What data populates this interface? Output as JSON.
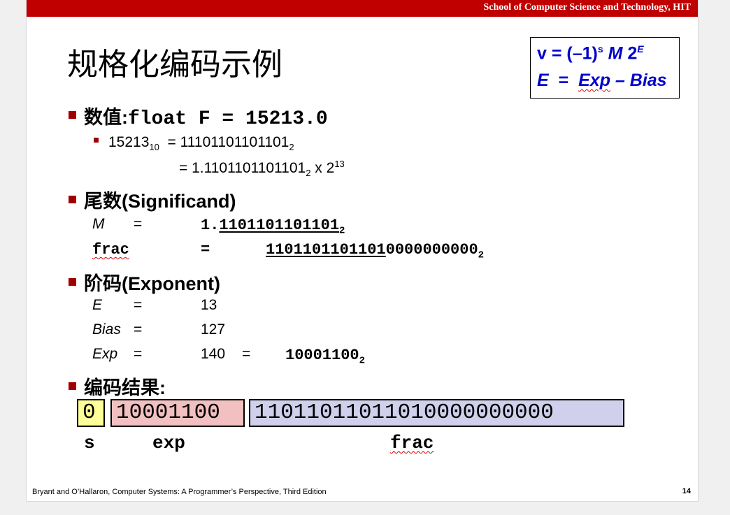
{
  "header": {
    "institution": "School of Computer Science and Technology, HIT"
  },
  "title": "规格化编码示例",
  "formula": {
    "line1_prefix": "v = (–1)",
    "line1_sup_s": "s",
    "line1_m": "M",
    "line1_two": "2",
    "line1_sup_e": "E",
    "line2_e": "E",
    "line2_eq": "=",
    "line2_exp": "Exp",
    "line2_rest": "– Bias"
  },
  "value_section": {
    "label": "数值:",
    "code": "float F = 15213.0",
    "line1_num": "15213",
    "line1_sub": "10",
    "line1_rest": "= 11101101101101",
    "line1_sub2": "2",
    "line2_rest": "= 1.1101101101101",
    "line2_sub": "2",
    "line2_x": "x 2",
    "line2_sup": "13"
  },
  "significand": {
    "label": "尾数(Significand)",
    "m_name": "M",
    "m_eq": "=",
    "m_prefix": "1.",
    "m_value": "1101101101101",
    "m_sub": "2",
    "frac_name": "frac",
    "frac_eq": "=",
    "frac_underlined": "1101101101101",
    "frac_rest": "0000000000",
    "frac_sub": "2"
  },
  "exponent": {
    "label": "阶码(Exponent)",
    "rows": [
      {
        "name": "E",
        "eq": "=",
        "value": "13"
      },
      {
        "name": "Bias",
        "eq": "=",
        "value": "127"
      },
      {
        "name": "Exp",
        "eq": "=",
        "value": "140"
      }
    ],
    "exp_eq2": "=",
    "exp_bin": "10001100",
    "exp_sub": "2"
  },
  "encoding": {
    "label": "编码结果:",
    "sign_bit": "0",
    "exp_bits": "10001100",
    "frac_bits": "11011011011010000000000",
    "s_label": "s",
    "exp_label": "exp",
    "frac_label": "frac",
    "colors": {
      "sign": "#ffff99",
      "exp": "#f2c0c0",
      "frac": "#d0d0ec"
    }
  },
  "footer": {
    "citation": "Bryant and O’Hallaron, Computer Systems: A Programmer’s Perspective, Third Edition",
    "page": "14"
  },
  "colors": {
    "header": "#c00000",
    "bullet": "#a00000",
    "formula": "#0000cc"
  }
}
